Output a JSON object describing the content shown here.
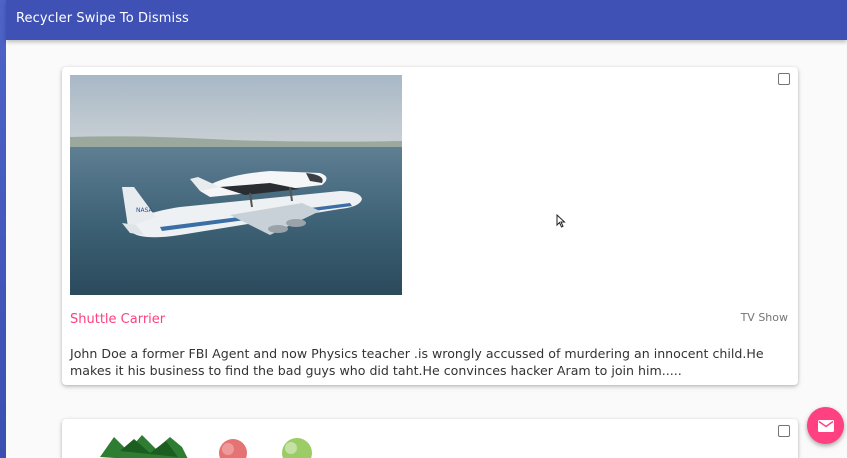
{
  "app": {
    "title": "Recycler Swipe To Dismiss"
  },
  "cards": [
    {
      "title": "Shuttle Carrier",
      "category": "TV Show",
      "description": " John Doe a former FBI Agent and now Physics teacher .is wrongly accussed of murdering an innocent child.He makes it his business to find the bad guys who did taht.He convinces hacker Aram to join him.....",
      "image": "space-shuttle-on-747-photo",
      "checked": false
    },
    {
      "image": "fruit-photo",
      "checked": false
    }
  ],
  "fab": {
    "icon": "email-icon"
  },
  "colors": {
    "primary": "#3f51b5",
    "accent": "#ff4081",
    "background": "#fafafa"
  }
}
